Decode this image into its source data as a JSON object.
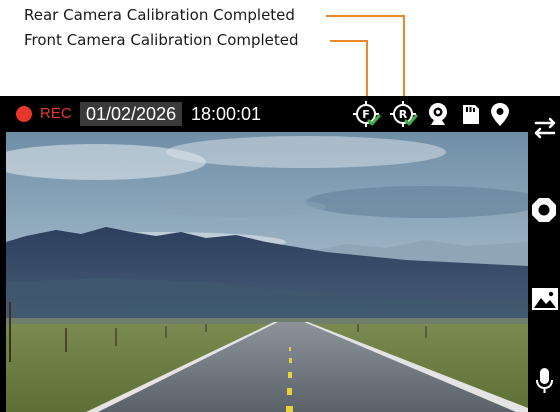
{
  "annotations": {
    "rear_calibration": "Rear Camera Calibration Completed",
    "front_calibration": "Front Camera Calibration Completed"
  },
  "status_bar": {
    "rec_label": "REC",
    "date": "01/02/2026",
    "time": "18:00:01",
    "front_badge": "F",
    "rear_badge": "R",
    "icons": [
      "front-camera-calibrated-icon",
      "rear-camera-calibrated-icon",
      "webcam-icon",
      "sd-card-icon",
      "location-pin-icon"
    ]
  },
  "side_bar": {
    "icons": [
      "switch-camera-icon",
      "stop-record-icon",
      "gallery-icon",
      "microphone-icon"
    ]
  },
  "colors": {
    "rec": "#e8362c",
    "leader_line": "#e88a2b",
    "check_mark": "#3fae49",
    "date_box": "#3a3a3a"
  }
}
